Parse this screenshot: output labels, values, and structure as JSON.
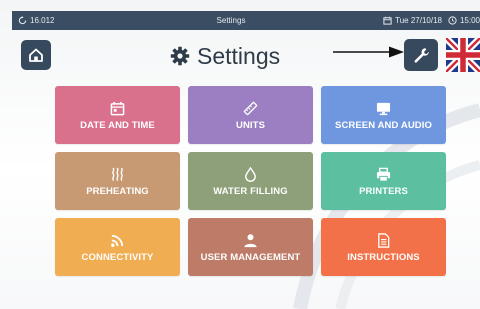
{
  "status_bar": {
    "version": "16.012",
    "title": "Settings",
    "date": "Tue 27/10/18",
    "time": "15:00"
  },
  "header": {
    "title": "Settings",
    "home_icon": "home-icon",
    "settings_icon": "gear-icon",
    "tools_icon": "wrench-icon",
    "language_flag": "uk-flag"
  },
  "tiles": [
    {
      "label": "DATE AND TIME",
      "icon": "calendar-icon",
      "color": "#d9718d"
    },
    {
      "label": "UNITS",
      "icon": "ruler-icon",
      "color": "#9b7fc2"
    },
    {
      "label": "SCREEN AND AUDIO",
      "icon": "monitor-icon",
      "color": "#6f97df"
    },
    {
      "label": "PREHEATING",
      "icon": "heat-icon",
      "color": "#c89a74"
    },
    {
      "label": "WATER FILLING",
      "icon": "water-drop-icon",
      "color": "#8ea07a"
    },
    {
      "label": "PRINTERS",
      "icon": "printer-icon",
      "color": "#5cc0a0"
    },
    {
      "label": "CONNECTIVITY",
      "icon": "wifi-icon",
      "color": "#f0ad52"
    },
    {
      "label": "USER MANAGEMENT",
      "icon": "user-icon",
      "color": "#bd7b68"
    },
    {
      "label": "INSTRUCTIONS",
      "icon": "document-icon",
      "color": "#f37148"
    }
  ],
  "colors": {
    "status_bar": "#3b4d63",
    "header_button": "#37495c",
    "title_text": "#2f3b48"
  }
}
